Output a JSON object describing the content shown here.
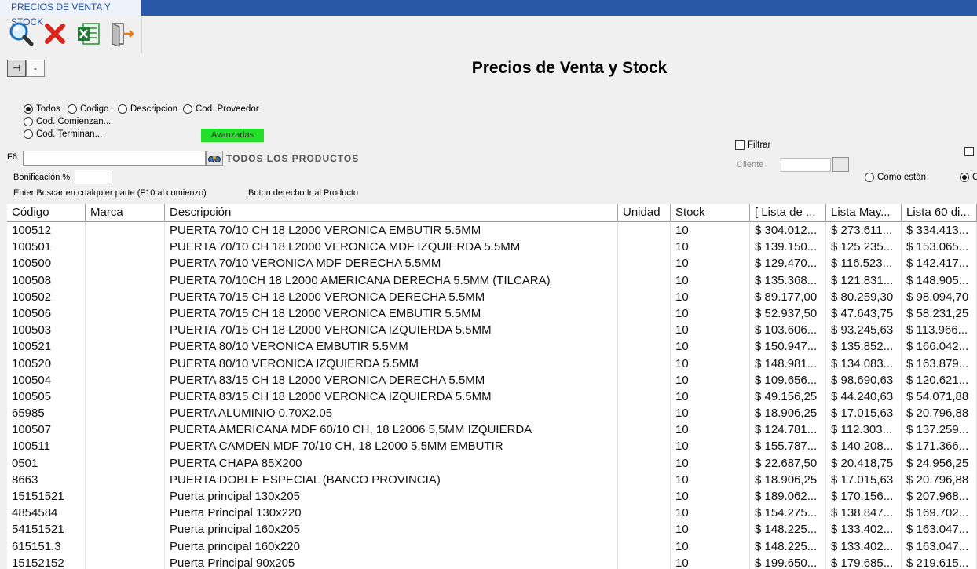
{
  "window": {
    "tab_title": "PRECIOS DE VENTA Y STOCK"
  },
  "toolbar": {
    "buttons": [
      {
        "name": "search",
        "icon": "magnifier-icon"
      },
      {
        "name": "cancel",
        "icon": "red-x-icon"
      },
      {
        "name": "excel",
        "icon": "excel-icon"
      },
      {
        "name": "exit",
        "icon": "exit-door-icon"
      }
    ]
  },
  "pin": {
    "pin_label": "⊣",
    "minus_label": "-"
  },
  "page_title": "Precios de Venta y Stock",
  "filters": {
    "todos": "Todos",
    "codigo": "Codigo",
    "descripcion": "Descripcion",
    "cod_proveedor": "Cod. Proveedor",
    "cod_comienzan": "Cod. Comienzan...",
    "cod_terminan": "Cod. Terminan...",
    "selected": "Todos",
    "avanzadas": "Avanzadas"
  },
  "search": {
    "label": "F6",
    "value": "",
    "scope_label": "TODOS LOS PRODUCTOS"
  },
  "bonificacion": {
    "label": "Bonificación %",
    "value": ""
  },
  "hints": {
    "left": "Enter Buscar en cualquier parte (F10 al comienzo)",
    "right": "Boton derecho Ir al Producto"
  },
  "right_panel": {
    "filtrar_label": "Filtrar",
    "cliente_label": "Cliente",
    "cliente_value": "",
    "como_estan_label": "Como están",
    "partial_radio_label": "C"
  },
  "grid": {
    "columns": [
      "Código",
      "Marca",
      "Descripción",
      "Unidad",
      "Stock",
      "[ Lista de ...",
      "Lista May...",
      "Lista 60 di..."
    ],
    "rows": [
      [
        "100512",
        "",
        "PUERTA 70/10 CH 18 L2000 VERONICA EMBUTIR 5.5MM",
        "",
        "10",
        "$ 304.012...",
        "$ 273.611...",
        "$ 334.413..."
      ],
      [
        "100501",
        "",
        "PUERTA 70/10 CH 18 L2000 VERONICA MDF IZQUIERDA 5.5MM",
        "",
        "10",
        "$ 139.150...",
        "$ 125.235...",
        "$ 153.065..."
      ],
      [
        "100500",
        "",
        "PUERTA 70/10 VERONICA MDF DERECHA 5.5MM",
        "",
        "10",
        "$ 129.470...",
        "$ 116.523...",
        "$ 142.417..."
      ],
      [
        "100508",
        "",
        "PUERTA 70/10CH 18 L2000 AMERICANA DERECHA 5.5MM (TILCARA)",
        "",
        "10",
        "$ 135.368...",
        "$ 121.831...",
        "$ 148.905..."
      ],
      [
        "100502",
        "",
        "PUERTA 70/15 CH 18 L2000 VERONICA DERECHA 5.5MM",
        "",
        "10",
        "$ 89.177,00",
        "$ 80.259,30",
        "$ 98.094,70"
      ],
      [
        "100506",
        "",
        "PUERTA 70/15 CH 18 L2000 VERONICA EMBUTIR 5.5MM",
        "",
        "10",
        "$ 52.937,50",
        "$ 47.643,75",
        "$ 58.231,25"
      ],
      [
        "100503",
        "",
        "PUERTA 70/15 CH 18 L2000 VERONICA IZQUIERDA 5.5MM",
        "",
        "10",
        "$ 103.606...",
        "$ 93.245,63",
        "$ 113.966..."
      ],
      [
        "100521",
        "",
        "PUERTA 80/10 VERONICA EMBUTIR 5.5MM",
        "",
        "10",
        "$ 150.947...",
        "$ 135.852...",
        "$ 166.042..."
      ],
      [
        "100520",
        "",
        "PUERTA 80/10 VERONICA IZQUIERDA 5.5MM",
        "",
        "10",
        "$ 148.981...",
        "$ 134.083...",
        "$ 163.879..."
      ],
      [
        "100504",
        "",
        "PUERTA 83/15 CH 18 L2000 VERONICA DERECHA 5.5MM",
        "",
        "10",
        "$ 109.656...",
        "$ 98.690,63",
        "$ 120.621..."
      ],
      [
        "100505",
        "",
        "PUERTA 83/15 CH 18 L2000 VERONICA IZQUIERDA 5.5MM",
        "",
        "10",
        "$ 49.156,25",
        "$ 44.240,63",
        "$ 54.071,88"
      ],
      [
        "65985",
        "",
        "PUERTA ALUMINIO 0.70X2.05",
        "",
        "10",
        "$ 18.906,25",
        "$ 17.015,63",
        "$ 20.796,88"
      ],
      [
        "100507",
        "",
        "PUERTA AMERICANA MDF 60/10 CH, 18 L2006 5,5MM IZQUIERDA",
        "",
        "10",
        "$ 124.781...",
        "$ 112.303...",
        "$ 137.259..."
      ],
      [
        "100511",
        "",
        "PUERTA CAMDEN MDF 70/10 CH, 18 L2000 5,5MM EMBUTIR",
        "",
        "10",
        "$ 155.787...",
        "$ 140.208...",
        "$ 171.366..."
      ],
      [
        "0501",
        "",
        "PUERTA CHAPA 85X200",
        "",
        "10",
        "$ 22.687,50",
        "$ 20.418,75",
        "$ 24.956,25"
      ],
      [
        "8663",
        "",
        "PUERTA DOBLE ESPECIAL (BANCO PROVINCIA)",
        "",
        "10",
        "$ 18.906,25",
        "$ 17.015,63",
        "$ 20.796,88"
      ],
      [
        "15151521",
        "",
        "Puerta principal 130x205",
        "",
        "10",
        "$ 189.062...",
        "$ 170.156...",
        "$ 207.968..."
      ],
      [
        "4854584",
        "",
        "Puerta Principal 130x220",
        "",
        "10",
        "$ 154.275...",
        "$ 138.847...",
        "$ 169.702..."
      ],
      [
        "54151521",
        "",
        "Puerta principal 160x205",
        "",
        "10",
        "$ 148.225...",
        "$ 133.402...",
        "$ 163.047..."
      ],
      [
        "615151.3",
        "",
        "Puerta principal 160x220",
        "",
        "10",
        "$ 148.225...",
        "$ 133.402...",
        "$ 163.047..."
      ],
      [
        "15152152",
        "",
        "Puerta Principal 90x205",
        "",
        "10",
        "$ 199.650...",
        "$ 179.685...",
        "$ 219.615..."
      ]
    ]
  },
  "colors": {
    "titlebar": "#2a58a8",
    "avanzadas": "#22e02a",
    "background": "#f0f0f0"
  }
}
